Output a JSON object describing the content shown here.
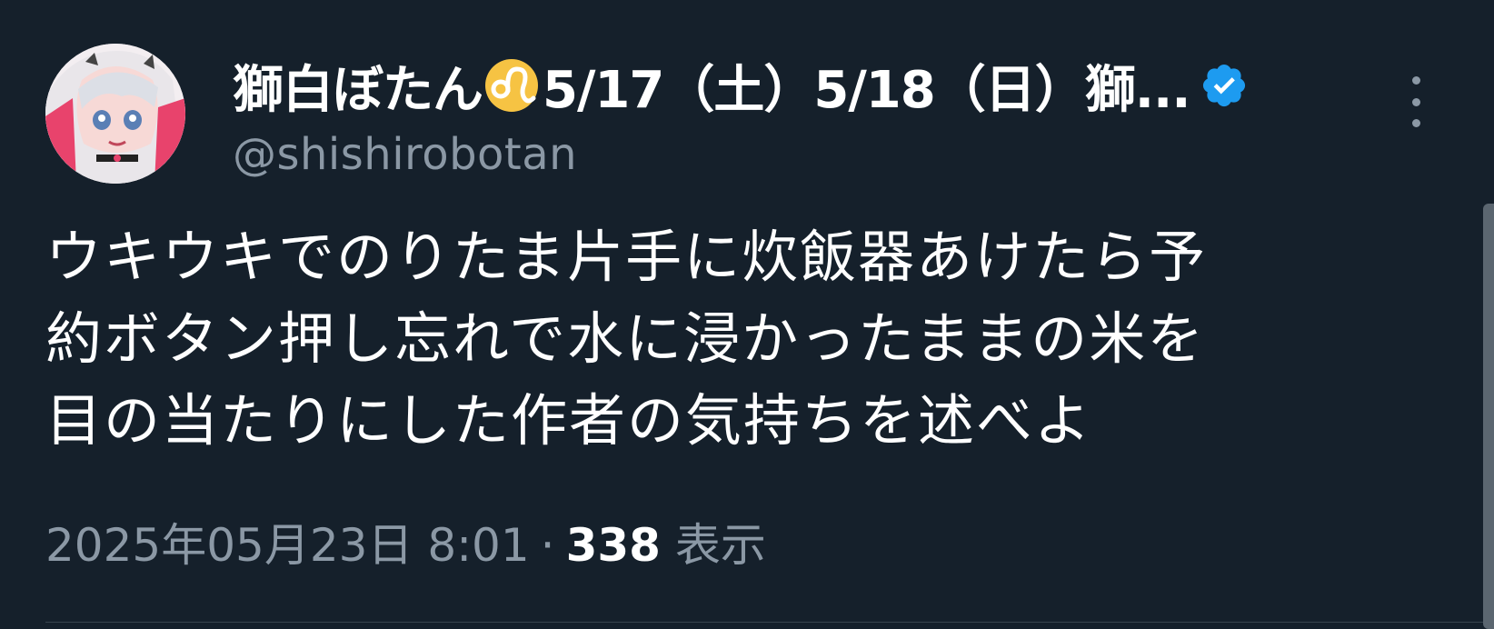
{
  "tweet": {
    "author": {
      "display_name": "獅白ぼたん",
      "name_suffix": "5/17（土）5/18（日）獅...",
      "handle": "@shishirobotan",
      "verified": true,
      "emoji_icon": "leo-zodiac-icon",
      "avatar_icon": "anime-avatar-icon"
    },
    "more_icon": "vertical-ellipsis-icon",
    "text_lines": [
      "ウキウキでのりたま片手に炊飯器あけたら予",
      "約ボタン押し忘れで水に浸かったままの米を",
      "目の当たりにした作者の気持ちを述べよ"
    ],
    "timestamp": "2025年05月23日 8:01",
    "separator": "·",
    "views_count": "338",
    "views_label": "表示"
  },
  "colors": {
    "background": "#15202b",
    "text_primary": "#ffffff",
    "text_secondary": "#8b98a5",
    "verified_blue": "#1d9bf0",
    "leo_yellow": "#f6c343"
  }
}
